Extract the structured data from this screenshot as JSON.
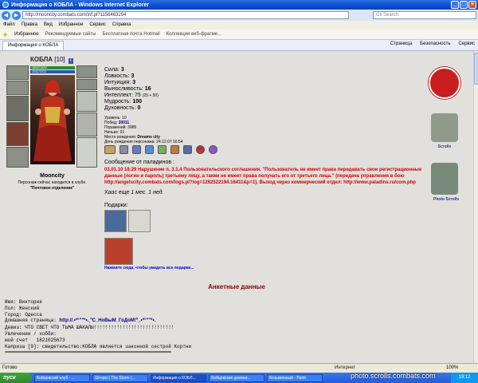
{
  "window": {
    "title": "Информация о КОБЛА - Windows Internet Explorer",
    "url": "http://mooncity.combats.com/inf.pl?1156463294",
    "search_placeholder": "Gli Search"
  },
  "menu": [
    "Файл",
    "Правка",
    "Вид",
    "Избранное",
    "Сервис",
    "Справка"
  ],
  "favbar": {
    "favorites": "Избранное",
    "links": [
      "Рекомендуемые сайты",
      "Бесплатная почта Hotmail",
      "Коллекция веб-фрагме..."
    ]
  },
  "tabs": {
    "active": "Информация о КОБЛА",
    "tools": [
      "Страница",
      "Безопасность",
      "Сервис"
    ]
  },
  "character": {
    "name": "КОБЛА",
    "level": "[10]",
    "hp": "1892/1892",
    "mp": "1011/1011",
    "city": "Mooncity",
    "location_note": "Персонаж сейчас находится в клубе.",
    "location": "\"Почтовое отделение\""
  },
  "stats": [
    {
      "label": "Сила:",
      "value": "3"
    },
    {
      "label": "Ловкость:",
      "value": "3"
    },
    {
      "label": "Интуиция:",
      "value": "3"
    },
    {
      "label": "Выносливость:",
      "value": "16"
    },
    {
      "label": "Интеллект:",
      "value": "75",
      "extra": "(25 + 50)"
    },
    {
      "label": "Мудрость:",
      "value": "100"
    },
    {
      "label": "Духовность:",
      "value": "0"
    }
  ],
  "info": {
    "level": "Уровень: 10",
    "wins_label": "Побед:",
    "wins": "30011",
    "losses": "Поражений: 3985",
    "draws": "Ничьих: 91",
    "birthplace_label": "Место рождения:",
    "birthplace": "Dreams city",
    "birthday": "День рождения персонажа: 24.12.07 16:54"
  },
  "message": {
    "header": "Сообщение от паладинов :",
    "text": "03.01.10 18:29 Нарушение п. 3.1.4 Пользовательского соглашения. \"Пользователь не имеет права передавать свои регистрационные данные (логин и пароль) третьему лицу, а также не имеет права получать его от третьего лица.\" (передача управления в бою http://angelscity.combats.com/logs.pl?log=1262522194.16411&p=1). Выход через коммерческий отдел: http://www.paladins.ru/com.php",
    "chaos_prefix": "Хаос еще ",
    "chaos_time": "1 мес. 1 нед."
  },
  "gifts": {
    "label": "Подарки:",
    "link": "Нажмите сюда, чтобы увидеть все подарки..."
  },
  "emblems": {
    "scrolls": "Scrolls",
    "photo": "Photo Scrolls"
  },
  "anketa": {
    "title": "Анкетные данные",
    "name": "Имя: Виктория",
    "gender": "Пол: Женский",
    "city": "Город: Одесса",
    "homepage_label": "Домашняя страница: ",
    "homepage": "http://.•*°\"\"*•.¸ºС_НоВыМ_ГоДоМ!º¸.•*°\"\"*•.",
    "motto": "Девиз: ЧТО СВЕТ ЧТО ТЬМА ШАКАЛЫ!!!!!!!!!!!!!!!!!!!!!!!!!!!!",
    "hobby": "Увлечения / хобби:",
    "account": "мой счет   1821025673",
    "whim": "Каприза [9]: свидетельство:КОБЛА является законной сестрой Кортни",
    "separator": "================================================================================"
  },
  "statusbar": {
    "status": "Готово",
    "zone": "Интернет",
    "zoom": "100%"
  },
  "taskbar": {
    "start": "пуск",
    "tasks": [
      "Бойцовский клуб - ...",
      "Шторм ( The Storm (...",
      "Информация о КОБЛ...",
      "Бойцовские дневни...",
      "Безымянный - Paint"
    ],
    "active_index": 2,
    "clock": "19:12"
  },
  "watermark": "photo.scrolls.combats.com"
}
